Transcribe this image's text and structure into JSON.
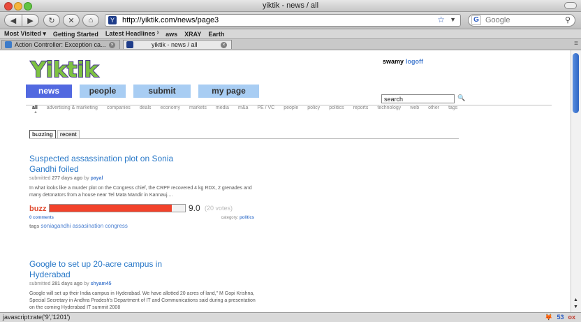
{
  "window": {
    "title": "yiktik - news / all"
  },
  "toolbar": {
    "url": "http://yiktik.com/news/page3",
    "search_placeholder": "Google"
  },
  "bookmarks": [
    "Most Visited ▾",
    "Getting Started",
    "Latest Headlines ⁾",
    "aws",
    "XRAY",
    "Earth"
  ],
  "tabs": [
    {
      "label": "Action Controller: Exception ca..."
    },
    {
      "label": "yiktik - news / all"
    }
  ],
  "site": {
    "logo_text": "Yiktik",
    "user": "swamy",
    "logoff": "logoff",
    "nav": [
      "news",
      "people",
      "submit",
      "my page"
    ],
    "search_value": "search",
    "categories": [
      "all",
      "advertising & marketing",
      "companies",
      "deals",
      "economy",
      "markets",
      "media",
      "m&a",
      "PE / VC",
      "people",
      "policy",
      "politics",
      "reports",
      "technology",
      "web",
      "other",
      "tags"
    ],
    "subtabs": [
      "buzzing",
      "recent"
    ]
  },
  "stories": [
    {
      "headline": "Suspected assassination plot on Sonia Gandhi foiled",
      "submitted": "submitted",
      "age": "277 days ago",
      "by": "by",
      "user": "payal",
      "summary": "In what looks like a murder plot on the Congress chief, the CRPF recovered 4 kg RDX, 2 grenades and many detonators from a house near Tel Mata Mandir in Kannauj....",
      "buzz_label": "buzz",
      "buzz_score": 9.0,
      "buzz_score_text": "9.0",
      "votes_text": "(20 votes)",
      "comments": "0 comments",
      "category_label": "category:",
      "category": "politics",
      "tags_label": "tags",
      "tags": "soniagandhi assasination congress"
    },
    {
      "headline": "Google to set up 20-acre campus in Hyderabad",
      "submitted": "submitted",
      "age": "281 days ago",
      "by": "by",
      "user": "shyam45",
      "summary": "Google will set up their India campus in Hyderabad. We have allotted 20 acres of land,\" M Gopi Krishna, Special Secretary in Andhra Pradesh's Department of IT and Communications said during a presentation on the coming Hyderabad IT summit 2008"
    }
  ],
  "status": {
    "text": "javascript:rate('9','1201')",
    "right": [
      "🦊",
      "53",
      "ox"
    ]
  }
}
